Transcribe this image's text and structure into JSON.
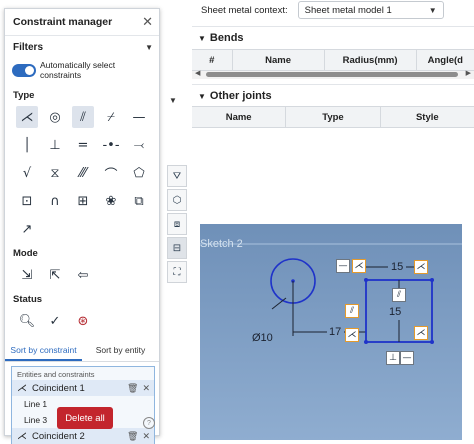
{
  "panel": {
    "title": "Constraint manager",
    "filters_label": "Filters",
    "auto_select_label": "Automatically select constraints",
    "type_label": "Type",
    "mode_label": "Mode",
    "status_label": "Status",
    "type_icons": [
      "coincident-icon",
      "concentric-icon",
      "parallel-icon",
      "tangent-icon",
      "horizontal-icon",
      "vertical-icon",
      "perpendicular-icon",
      "equal-icon",
      "midpoint-icon",
      "normal-icon",
      "pierce-icon",
      "symmetric-icon",
      "pattern-icon",
      "curvature-icon",
      "rigid-icon",
      "projected-icon",
      "u-shape-icon",
      "grid-pattern-icon",
      "circular-pattern-icon",
      "offset-icon",
      "fix-icon"
    ],
    "tabs": [
      "Sort by constraint",
      "Sort by entity"
    ],
    "list_header": "Entities and constraints",
    "items": [
      {
        "label": "Coincident 1"
      },
      {
        "label": "Line 1"
      },
      {
        "label": "Line 3"
      },
      {
        "label": "Coincident 2"
      }
    ],
    "delete_label": "Delete all",
    "help": "?"
  },
  "sheet_metal": {
    "context_label": "Sheet metal context:",
    "context_value": "Sheet metal model 1",
    "bends_title": "Bends",
    "bends_columns": [
      "#",
      "Name",
      "Radius(mm)",
      "Angle(d"
    ],
    "joints_title": "Other joints",
    "joints_columns": [
      "Name",
      "Type",
      "Style"
    ]
  },
  "viewport": {
    "sketch_label": "Sketch 2",
    "dim_diameter": "Ø10",
    "dim_17": "17",
    "dim_15_top": "15",
    "dim_15_side": "15",
    "colors": {
      "sketch_line": "#1f33c9",
      "background": "#7a9abf",
      "highlight_box": "#e39a2d"
    }
  }
}
